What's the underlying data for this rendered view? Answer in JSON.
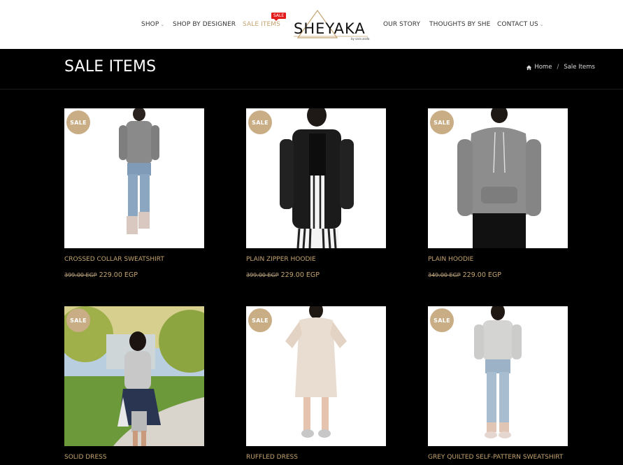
{
  "nav": {
    "shop": "SHOP",
    "shop_by_designer": "SHOP BY DESIGNER",
    "sale_items": "SALE ITEMS",
    "sale_flag": "SALE",
    "our_story": "OUR STORY",
    "thoughts_by_she": "THOUGHTS BY SHE",
    "contact_us": "CONTACT US"
  },
  "logo": {
    "text": "SHEYAKA",
    "tagline": "by sara arafa"
  },
  "page": {
    "title": "SALE ITEMS",
    "breadcrumb": {
      "home": "Home",
      "separator": "/",
      "current": "Sale Items"
    }
  },
  "products": [
    {
      "badge": "SALE",
      "name": "CROSSED COLLAR SWEATSHIRT",
      "old_price": "399.00 EGP",
      "price": "229.00 EGP"
    },
    {
      "badge": "SALE",
      "name": "PLAIN ZIPPER HOODIE",
      "old_price": "399.00 EGP",
      "price": "229.00 EGP"
    },
    {
      "badge": "SALE",
      "name": "PLAIN HOODIE",
      "old_price": "349.00 EGP",
      "price": "229.00 EGP"
    },
    {
      "badge": "SALE",
      "name": "SOLID DRESS"
    },
    {
      "badge": "SALE",
      "name": "RUFFLED DRESS"
    },
    {
      "badge": "SALE",
      "name": "GREY QUILTED SELF-PATTERN SWEATSHIRT"
    }
  ],
  "colors": {
    "accent": "#c4a471",
    "badge": "#c9ad84",
    "sale_flag": "#e21b1b",
    "background": "#000000"
  }
}
